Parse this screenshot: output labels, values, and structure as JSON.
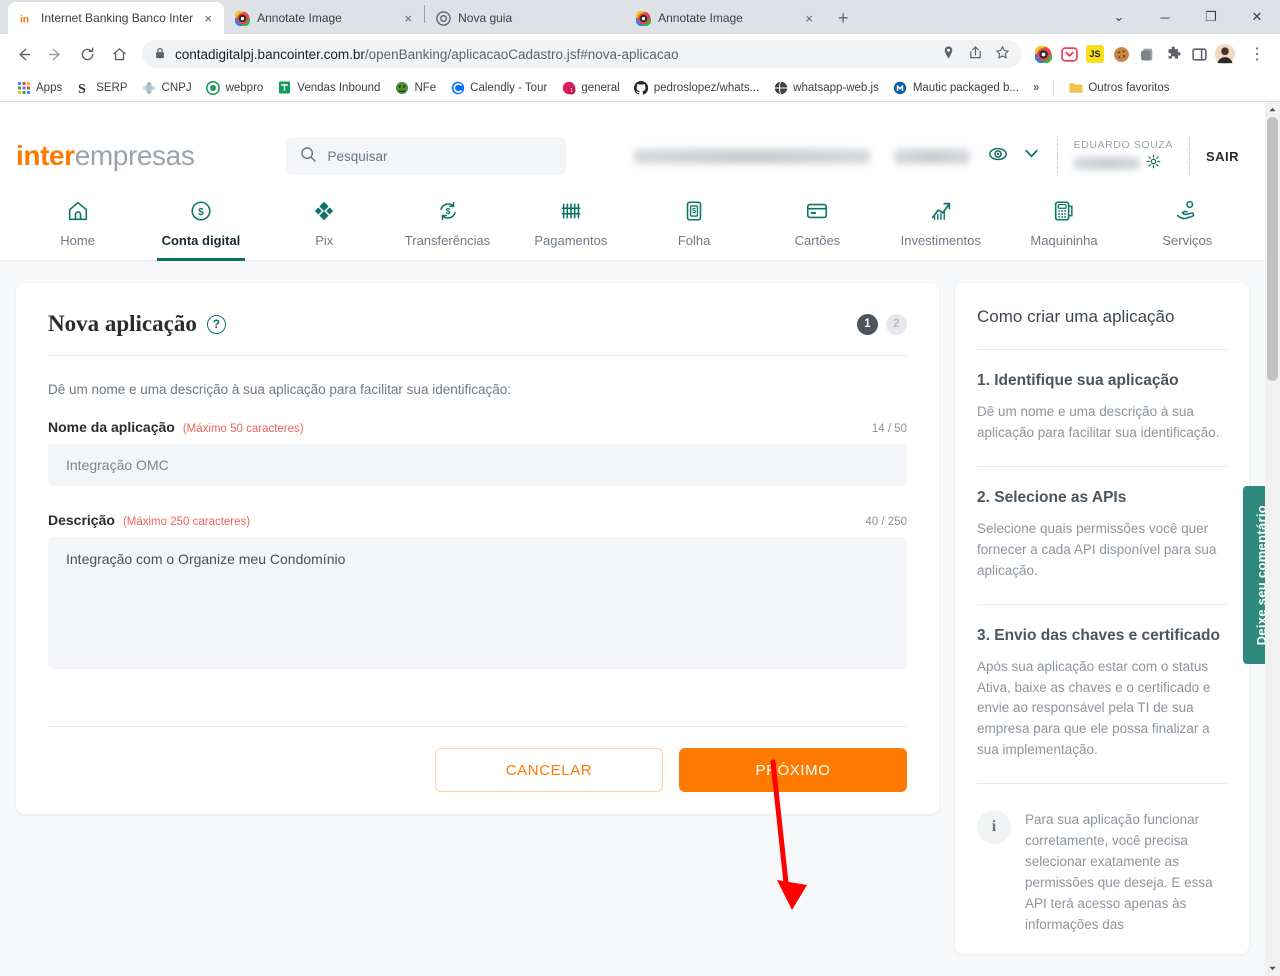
{
  "browser": {
    "tabs": [
      {
        "title": "Internet Banking Banco Inter",
        "favicon": "inter-logo-icon",
        "active": true,
        "close_label": "×"
      },
      {
        "title": "Annotate Image",
        "favicon": "annotate-icon",
        "active": false,
        "close_label": "×"
      },
      {
        "title": "Nova guia",
        "favicon": "chrome-icon",
        "active": false,
        "close_label": ""
      },
      {
        "title": "Annotate Image",
        "favicon": "annotate-icon",
        "active": false,
        "close_label": "×"
      }
    ],
    "new_tab_label": "+",
    "window_controls": {
      "list": "⌄",
      "minimize": "─",
      "maximize": "❐",
      "close": "✕"
    },
    "nav": {
      "back": "←",
      "forward": "→",
      "reload": "⟳",
      "home": "⌂"
    },
    "omnibox": {
      "lock_icon": "lock-icon",
      "url_host": "contadigitalpj.bancointer.com.br",
      "url_path": "/openBanking/aplicacaoCadastro.jsf#nova-aplicacao",
      "icons": [
        "location-pin-icon",
        "share-icon",
        "star-icon"
      ]
    },
    "extensions": [
      "annotate-ext-icon",
      "pocket-ext-icon",
      "js-ext-icon",
      "cookie-ext-icon",
      "tabs-ext-icon",
      "puzzle-ext-icon",
      "sidepanel-ext-icon"
    ],
    "profile": "avatar",
    "menu": "⋮",
    "bookmarks": [
      {
        "label": "Apps",
        "icon": "apps-grid-icon"
      },
      {
        "label": "SERP",
        "icon": "serp-icon"
      },
      {
        "label": "CNPJ",
        "icon": "cnpj-icon"
      },
      {
        "label": "webpro",
        "icon": "webpro-icon"
      },
      {
        "label": "Vendas Inbound",
        "icon": "sheets-icon"
      },
      {
        "label": "NFe",
        "icon": "nfe-icon"
      },
      {
        "label": "Calendly - Tour",
        "icon": "calendly-icon"
      },
      {
        "label": "general",
        "icon": "general-icon"
      },
      {
        "label": "pedroslopez/whats...",
        "icon": "github-icon"
      },
      {
        "label": "whatsapp-web.js",
        "icon": "globe-icon"
      },
      {
        "label": "Mautic packaged b...",
        "icon": "mautic-icon"
      }
    ],
    "bookmarks_overflow": "»",
    "other_bookmarks": {
      "label": "Outros favoritos",
      "icon": "folder-icon"
    }
  },
  "site": {
    "logo": {
      "bold": "inter",
      "light": "empresas"
    },
    "search": {
      "placeholder": "Pesquisar",
      "icon": "search-icon"
    },
    "account": {
      "eye_icon": "eye-icon",
      "chevron_icon": "chevron-down-icon",
      "user_name": "EDUARDO SOUZA",
      "gear_icon": "gear-icon",
      "logout_label": "SAIR"
    },
    "nav_items": [
      {
        "label": "Home",
        "icon": "home-icon",
        "active": false
      },
      {
        "label": "Conta digital",
        "icon": "dollar-circle-icon",
        "active": true
      },
      {
        "label": "Pix",
        "icon": "pix-icon",
        "active": false
      },
      {
        "label": "Transferências",
        "icon": "transfer-icon",
        "active": false
      },
      {
        "label": "Pagamentos",
        "icon": "barcode-icon",
        "active": false
      },
      {
        "label": "Folha",
        "icon": "payroll-icon",
        "active": false
      },
      {
        "label": "Cartões",
        "icon": "card-icon",
        "active": false
      },
      {
        "label": "Investimentos",
        "icon": "chart-up-icon",
        "active": false
      },
      {
        "label": "Maquininha",
        "icon": "pos-terminal-icon",
        "active": false
      },
      {
        "label": "Serviços",
        "icon": "services-icon",
        "active": false
      }
    ]
  },
  "form": {
    "title": "Nova aplicação",
    "help_icon_label": "?",
    "steps": [
      {
        "label": "1",
        "active": true
      },
      {
        "label": "2",
        "active": false
      }
    ],
    "intro": "Dê um nome e uma descrição à sua aplicação para facilitar sua identificação:",
    "name_field": {
      "label": "Nome da aplicação",
      "hint": "(Máximo 50 caracteres)",
      "counter": "14 / 50",
      "value": "Integração OMC"
    },
    "desc_field": {
      "label": "Descrição",
      "hint": "(Máximo 250 caracteres)",
      "counter": "40 / 250",
      "value": "Integração com o Organize meu Condomínio"
    },
    "cancel_label": "CANCELAR",
    "next_label": "PRÓXIMO"
  },
  "sidebar": {
    "title": "Como criar uma aplicação",
    "sections": [
      {
        "heading": "1. Identifique sua aplicação",
        "body": "Dê um nome e uma descrição à sua aplicação para facilitar sua identificação."
      },
      {
        "heading": "2. Selecione as APIs",
        "body": "Selecione quais permissões você quer fornecer a cada API disponível para sua aplicação."
      },
      {
        "heading": "3. Envio das chaves e certificado",
        "body": "Após sua aplicação estar com o status Ativa, baixe as chaves e o certificado e envie ao responsável pela TI de sua empresa para que ele possa finalizar a sua implementação."
      }
    ],
    "note": {
      "icon": "info-icon",
      "icon_label": "i",
      "body": "Para sua aplicação funcionar corretamente, você precisa selecionar exatamente as permissões que deseja. E essa API terá acesso apenas às informações das"
    }
  },
  "feedback_tab": {
    "label": "Deixe seu comentário",
    "color": "#2f8a7e"
  },
  "annotation": {
    "type": "red-arrow",
    "color": "#ff0000"
  },
  "colors": {
    "brand_orange": "#ff7a00",
    "brand_teal": "#0c7469",
    "page_bg": "#f7f8fa",
    "field_bg": "#f3f5f8",
    "hint_red": "#f0635a"
  }
}
